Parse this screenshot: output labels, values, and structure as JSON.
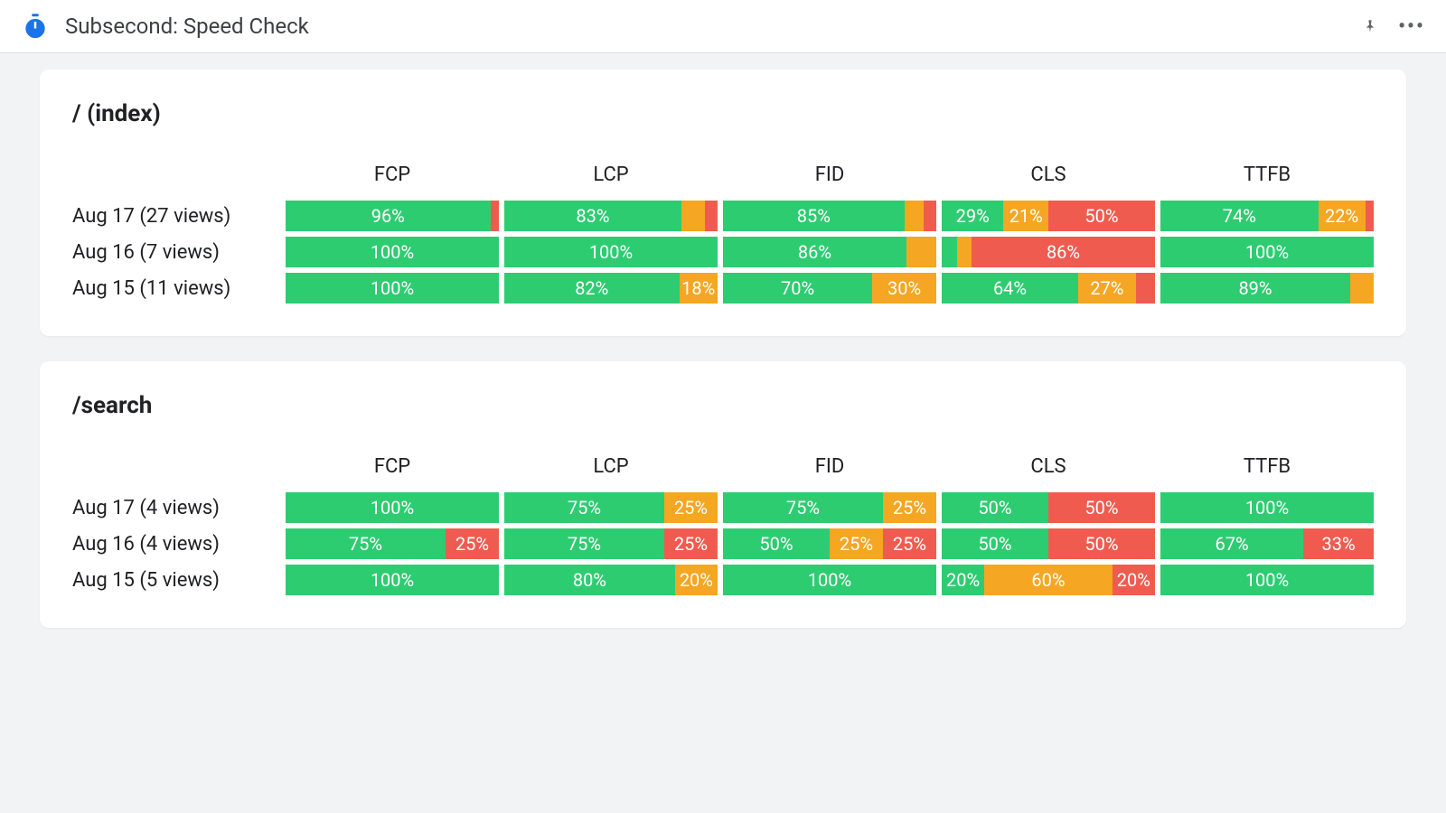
{
  "header": {
    "title": "Subsecond: Speed Check"
  },
  "metrics": [
    "FCP",
    "LCP",
    "FID",
    "CLS",
    "TTFB"
  ],
  "colors": {
    "good": "#2ecc71",
    "warn": "#f5a623",
    "poor": "#f05b4f"
  },
  "chart_data": [
    {
      "type": "bar",
      "title": "/ (index)",
      "categories": [
        "FCP",
        "LCP",
        "FID",
        "CLS",
        "TTFB"
      ],
      "unit": "percent",
      "series_meaning": "good / needs-improvement / poor distribution per Core Web Vital per day",
      "rows": [
        {
          "label": "Aug 17 (27 views)",
          "cells": [
            {
              "good": 96,
              "warn": 0,
              "poor": 4
            },
            {
              "good": 83,
              "warn": 11,
              "poor": 6
            },
            {
              "good": 85,
              "warn": 9,
              "poor": 6
            },
            {
              "good": 29,
              "warn": 21,
              "poor": 50
            },
            {
              "good": 74,
              "warn": 22,
              "poor": 4
            }
          ]
        },
        {
          "label": "Aug 16 (7 views)",
          "cells": [
            {
              "good": 100,
              "warn": 0,
              "poor": 0
            },
            {
              "good": 100,
              "warn": 0,
              "poor": 0
            },
            {
              "good": 86,
              "warn": 14,
              "poor": 0
            },
            {
              "good": 7,
              "warn": 7,
              "poor": 86
            },
            {
              "good": 100,
              "warn": 0,
              "poor": 0
            }
          ]
        },
        {
          "label": "Aug 15 (11 views)",
          "cells": [
            {
              "good": 100,
              "warn": 0,
              "poor": 0
            },
            {
              "good": 82,
              "warn": 18,
              "poor": 0
            },
            {
              "good": 70,
              "warn": 30,
              "poor": 0
            },
            {
              "good": 64,
              "warn": 27,
              "poor": 9
            },
            {
              "good": 89,
              "warn": 11,
              "poor": 0
            }
          ]
        }
      ]
    },
    {
      "type": "bar",
      "title": "/search",
      "categories": [
        "FCP",
        "LCP",
        "FID",
        "CLS",
        "TTFB"
      ],
      "unit": "percent",
      "series_meaning": "good / needs-improvement / poor distribution per Core Web Vital per day",
      "rows": [
        {
          "label": "Aug 17 (4 views)",
          "cells": [
            {
              "good": 100,
              "warn": 0,
              "poor": 0
            },
            {
              "good": 75,
              "warn": 25,
              "poor": 0
            },
            {
              "good": 75,
              "warn": 25,
              "poor": 0
            },
            {
              "good": 50,
              "warn": 0,
              "poor": 50
            },
            {
              "good": 100,
              "warn": 0,
              "poor": 0
            }
          ]
        },
        {
          "label": "Aug 16 (4 views)",
          "cells": [
            {
              "good": 75,
              "warn": 0,
              "poor": 25
            },
            {
              "good": 75,
              "warn": 0,
              "poor": 25
            },
            {
              "good": 50,
              "warn": 25,
              "poor": 25
            },
            {
              "good": 50,
              "warn": 0,
              "poor": 50
            },
            {
              "good": 67,
              "warn": 0,
              "poor": 33
            }
          ]
        },
        {
          "label": "Aug 15 (5 views)",
          "cells": [
            {
              "good": 100,
              "warn": 0,
              "poor": 0
            },
            {
              "good": 80,
              "warn": 20,
              "poor": 0
            },
            {
              "good": 100,
              "warn": 0,
              "poor": 0
            },
            {
              "good": 20,
              "warn": 60,
              "poor": 20
            },
            {
              "good": 100,
              "warn": 0,
              "poor": 0
            }
          ]
        }
      ]
    }
  ],
  "label_threshold": 18
}
